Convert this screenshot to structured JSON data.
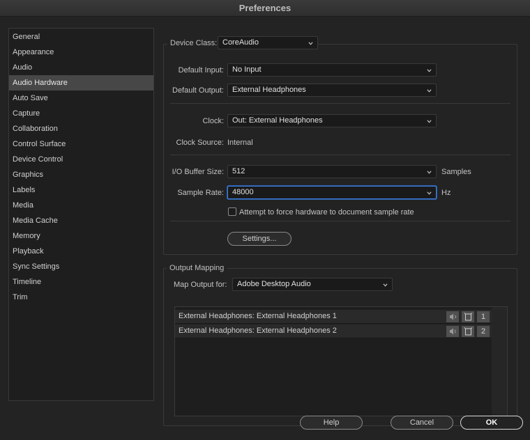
{
  "window": {
    "title": "Preferences"
  },
  "sidebar": {
    "items": [
      {
        "label": "General"
      },
      {
        "label": "Appearance"
      },
      {
        "label": "Audio"
      },
      {
        "label": "Audio Hardware",
        "selected": true
      },
      {
        "label": "Auto Save"
      },
      {
        "label": "Capture"
      },
      {
        "label": "Collaboration"
      },
      {
        "label": "Control Surface"
      },
      {
        "label": "Device Control"
      },
      {
        "label": "Graphics"
      },
      {
        "label": "Labels"
      },
      {
        "label": "Media"
      },
      {
        "label": "Media Cache"
      },
      {
        "label": "Memory"
      },
      {
        "label": "Playback"
      },
      {
        "label": "Sync Settings"
      },
      {
        "label": "Timeline"
      },
      {
        "label": "Trim"
      }
    ]
  },
  "device": {
    "class_label": "Device Class:",
    "class_value": "CoreAudio",
    "default_input_label": "Default Input:",
    "default_input_value": "No Input",
    "default_output_label": "Default Output:",
    "default_output_value": "External Headphones",
    "clock_label": "Clock:",
    "clock_value": "Out: External Headphones",
    "clock_source_label": "Clock Source:",
    "clock_source_value": "Internal",
    "buffer_label": "I/O Buffer Size:",
    "buffer_value": "512",
    "buffer_unit": "Samples",
    "rate_label": "Sample Rate:",
    "rate_value": "48000",
    "rate_unit": "Hz",
    "force_rate_label": "Attempt to force hardware to document sample rate",
    "force_rate_checked": false,
    "settings_button": "Settings..."
  },
  "output_mapping": {
    "legend": "Output Mapping",
    "map_for_label": "Map Output for:",
    "map_for_value": "Adobe Desktop Audio",
    "rows": [
      {
        "name": "External Headphones: External Headphones 1",
        "channel": "1"
      },
      {
        "name": "External Headphones: External Headphones 2",
        "channel": "2"
      }
    ]
  },
  "buttons": {
    "help": "Help",
    "cancel": "Cancel",
    "ok": "OK"
  },
  "colors": {
    "background": "#232323",
    "panel": "#1e1e1e",
    "selected": "#474747",
    "focus": "#3d7cd8"
  }
}
